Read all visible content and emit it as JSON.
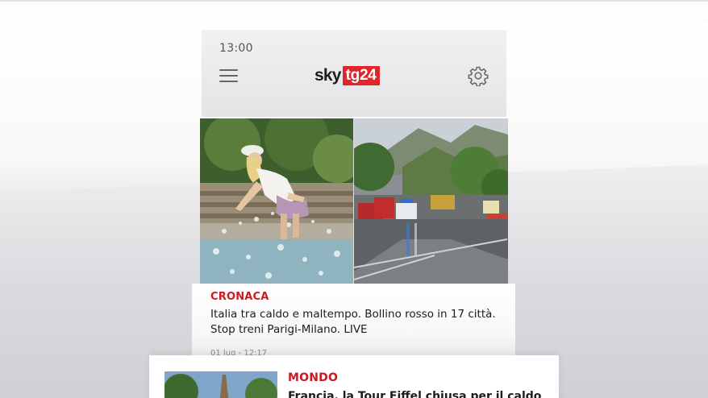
{
  "status_bar": {
    "time": "13:00"
  },
  "header": {
    "logo_sky": "sky",
    "logo_tg24": "tg24",
    "menu_icon": "hamburger-icon",
    "settings_icon": "gear-icon"
  },
  "colors": {
    "brand_red": "#e3242b",
    "category_red": "#d0161e"
  },
  "articles": [
    {
      "category": "CRONACA",
      "headline_line1": "Italia tra caldo e maltempo. Bollino rosso in 17 città.",
      "headline_line2": "Stop treni Parigi-Milano. LIVE",
      "timestamp": "01 lug - 12:17"
    },
    {
      "category": "MONDO",
      "headline": "Francia, la Tour Eiffel chiusa per il caldo"
    }
  ]
}
